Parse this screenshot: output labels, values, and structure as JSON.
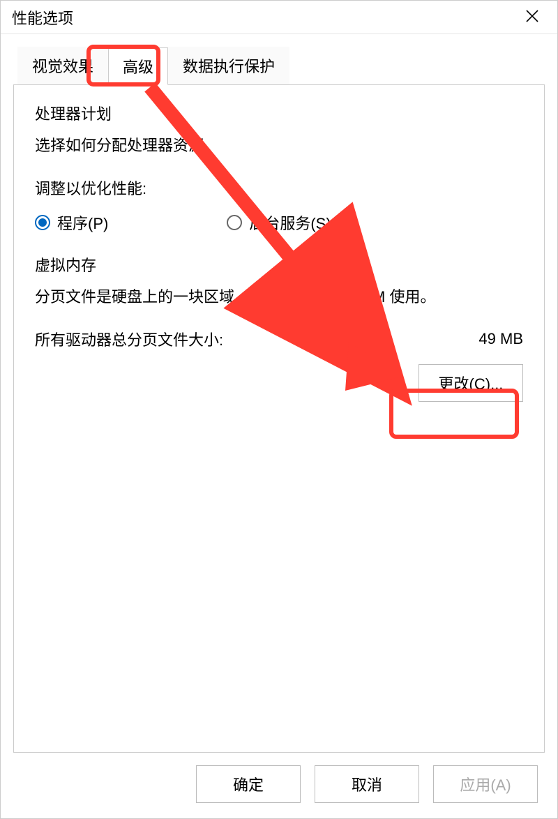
{
  "dialog": {
    "title": "性能选项"
  },
  "tabs": {
    "visual": "视觉效果",
    "advanced": "高级",
    "dep": "数据执行保护"
  },
  "processor": {
    "title": "处理器计划",
    "desc": "选择如何分配处理器资源。",
    "adjust_label": "调整以优化性能:",
    "programs": "程序(P)",
    "services": "后台服务(S)"
  },
  "vm": {
    "title": "虚拟内存",
    "desc": "分页文件是硬盘上的一块区域，Windows 当作 RAM 使用。",
    "total_label": "所有驱动器总分页文件大小:",
    "total_value": "49 MB",
    "change_btn": "更改(C)..."
  },
  "footer": {
    "ok": "确定",
    "cancel": "取消",
    "apply": "应用(A)"
  }
}
